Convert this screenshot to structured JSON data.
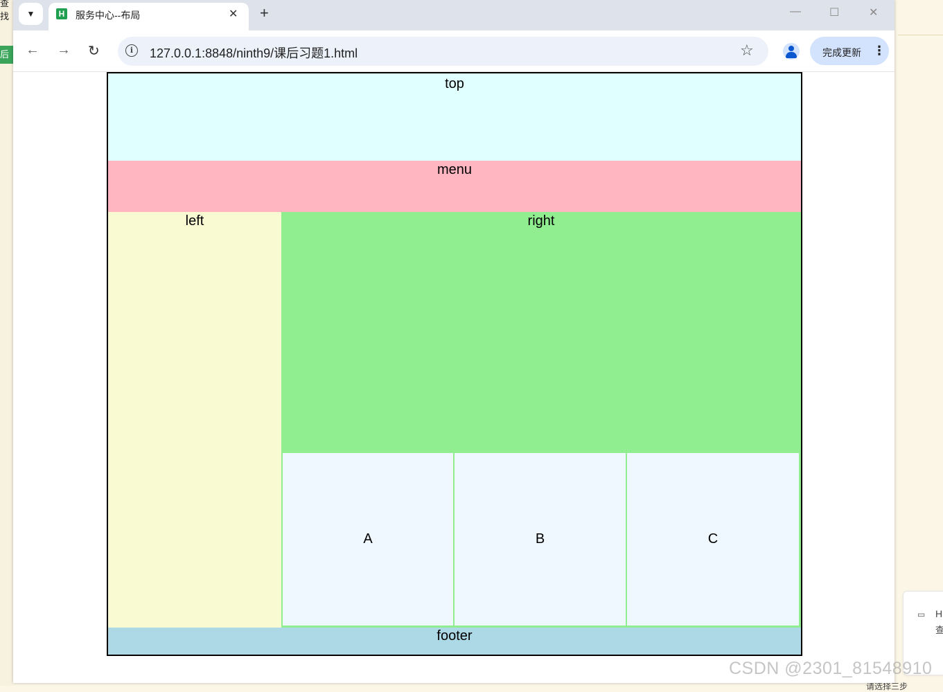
{
  "browser": {
    "tab_title": "服务中心--布局",
    "favicon_letter": "H",
    "url": "127.0.0.1:8848/ninth9/课后习题1.html",
    "update_button": "完成更新"
  },
  "layout": {
    "top": "top",
    "menu": "menu",
    "left": "left",
    "right": "right",
    "cells": [
      "A",
      "B",
      "C"
    ],
    "footer": "footer"
  },
  "colors": {
    "top": "#e0ffff",
    "menu": "#ffb6c1",
    "left": "#fafad2",
    "right": "#90ee90",
    "cells": "#f0f8ff",
    "footer": "#add8e6"
  },
  "watermark": "CSDN @2301_81548910",
  "background": {
    "left_fragment": "查找",
    "green_tag": "后文",
    "side_widget_text_1": "H",
    "side_widget_text_2": "查",
    "bottom_fragment": "请选择三步"
  }
}
